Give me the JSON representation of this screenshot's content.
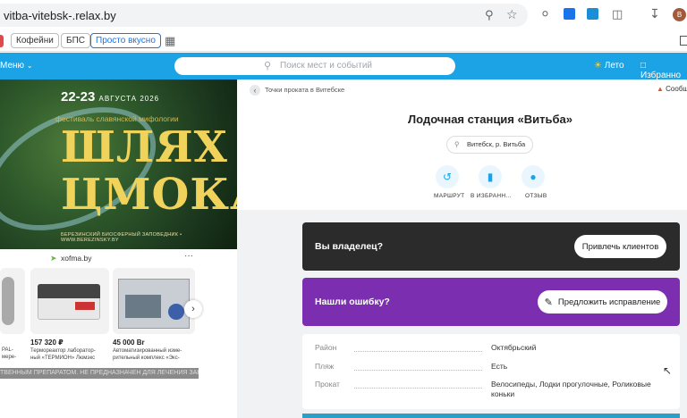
{
  "browser": {
    "url": "vitba-vitebsk-.relax.by",
    "bookmarks": [
      "Кофейни",
      "БПС",
      "Просто вкусно"
    ],
    "profile_initial": "B"
  },
  "site": {
    "menu_label": "Меню",
    "search_placeholder": "Поиск мест и событий",
    "weather_label": "Лето",
    "favorites_label": "Избранно"
  },
  "ad": {
    "date": "22-23",
    "month_year": "АВГУСТА 2026",
    "festival": "фестиваль славянской мифологии",
    "title_line1": "ШЛЯХ",
    "title_line2": "ЦМОКА",
    "footer": "БЕРЕЗИНСКИЙ БИОСФЕРНЫЙ ЗАПОВЕДНИК • WWW.BEREZINSKY.BY",
    "source": "xofma.by",
    "more": "···",
    "products": [
      {
        "price": "",
        "desc": "PAL-\nмере-"
      },
      {
        "price": "157 320 ₽",
        "desc": "Терморeактор лаборатор-\nный «ТЕРМИОН» Люмэкс"
      },
      {
        "price": "45 000 Br",
        "desc": "Автоматизированный изме-\nрительный комплекс «Экс-"
      }
    ],
    "warning": "ТВЕННЫМ ПРЕПАРАТОМ. НЕ ПРЕДНАЗНАЧЕН ДЛЯ ЛЕЧЕНИЯ ЗАБОЛЕВАНИ"
  },
  "place": {
    "breadcrumb": "Точки проката в Витебске",
    "report": "Сообщ",
    "title": "Лодочная станция «Витьба»",
    "address": "Витебск, р. Витьба",
    "actions": [
      {
        "label": "МАРШРУТ",
        "icon": "route-icon"
      },
      {
        "label": "В ИЗБРАНН...",
        "icon": "bookmark-icon"
      },
      {
        "label": "ОТЗЫВ",
        "icon": "comment-icon"
      }
    ]
  },
  "owner": {
    "text": "Вы владелец?",
    "button": "Привлечь клиентов"
  },
  "error": {
    "text": "Нашли ошибку?",
    "button": "Предложить исправление"
  },
  "details": [
    {
      "key": "Район",
      "value": "Октябрьский"
    },
    {
      "key": "Пляж",
      "value": "Есть"
    },
    {
      "key": "Прокат",
      "value": "Велосипеды, Лодки прогулочные, Роликовые коньки"
    }
  ],
  "colors": {
    "brand": "#1ba3e6",
    "owner_banner": "#2b2b2b",
    "error_banner": "#7b2fb0"
  }
}
